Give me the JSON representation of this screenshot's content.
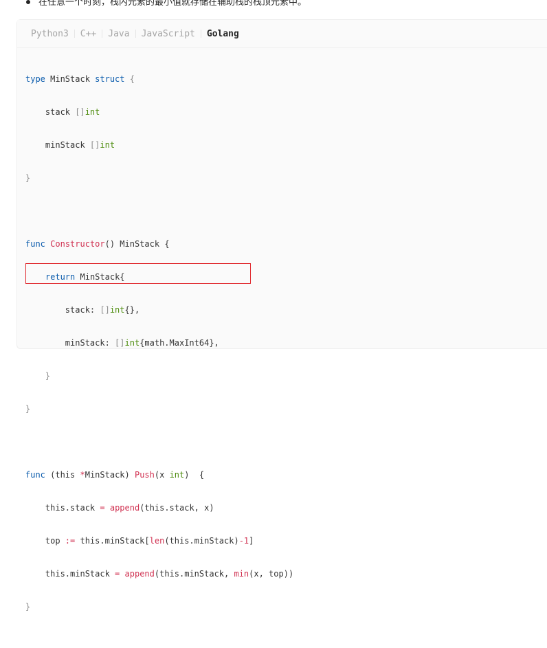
{
  "top_note": "在任意一个时刻，栈内元素的最小值就存储在辅助栈的栈顶元素中。",
  "tabs": [
    {
      "label": "Python3"
    },
    {
      "label": "C++"
    },
    {
      "label": "Java"
    },
    {
      "label": "JavaScript"
    },
    {
      "label": "Golang"
    }
  ],
  "active_tab": "Golang",
  "code": {
    "l1": {
      "a": "type",
      "b": " MinStack ",
      "c": "struct",
      "d": " {"
    },
    "l2": {
      "a": "    stack ",
      "b": "[]",
      "c": "int"
    },
    "l3": {
      "a": "    minStack ",
      "b": "[]",
      "c": "int"
    },
    "l4": {
      "a": "}"
    },
    "l6": {
      "a": "func",
      "b": " ",
      "c": "Constructor",
      "d": "() MinStack {"
    },
    "l7": {
      "a": "    ",
      "b": "return",
      "c": " MinStack{"
    },
    "l8": {
      "a": "        stack: ",
      "b": "[]",
      "c": "int",
      "d": "{},"
    },
    "l9": {
      "a": "        minStack: ",
      "b": "[]",
      "c": "int",
      "d": "{math.MaxInt64},"
    },
    "l10": {
      "a": "    }"
    },
    "l11": {
      "a": "}"
    },
    "l13": {
      "a": "func",
      "b": " (this ",
      "c": "*",
      "d": "MinStack) ",
      "e": "Push",
      "f": "(x ",
      "g": "int",
      "h": ")  {"
    },
    "l14": {
      "a": "    this.stack ",
      "b": "=",
      "c": " ",
      "d": "append",
      "e": "(this.stack, x)"
    },
    "l15": {
      "a": "    top ",
      "b": ":=",
      "c": " this.minStack[",
      "d": "len",
      "e": "(this.minStack)",
      "f": "-1",
      "g": "]"
    },
    "l16": {
      "a": "    this.minStack ",
      "b": "=",
      "c": " ",
      "d": "append",
      "e": "(this.minStack, ",
      "f": "min",
      "g": "(x, top))"
    },
    "l17": {
      "a": "}"
    }
  },
  "colors": {
    "keyword": "#0b5cad",
    "type": "#4d8c0d",
    "function": "#d03050",
    "highlight_border": "#e0292e"
  }
}
